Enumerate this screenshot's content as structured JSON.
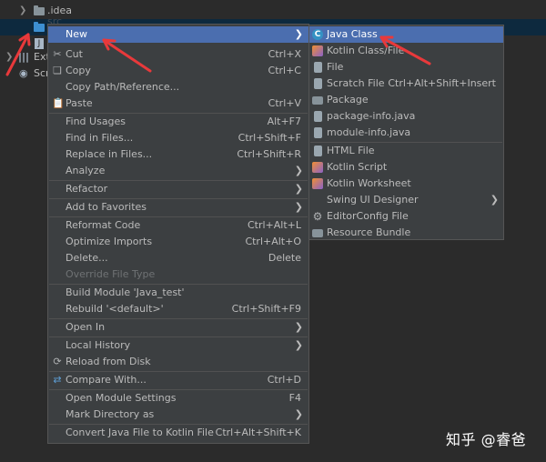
{
  "tree": {
    "items": [
      {
        "label": ".idea"
      },
      {
        "label": "src"
      },
      {
        "label": "J"
      },
      {
        "label": "Ext"
      },
      {
        "label": "Scr"
      }
    ]
  },
  "menu": {
    "items": [
      {
        "label": "New",
        "shortcut": "",
        "icon": "none"
      },
      {
        "label": "Cut",
        "shortcut": "Ctrl+X",
        "icon": "scissors-icon"
      },
      {
        "label": "Copy",
        "shortcut": "Ctrl+C",
        "icon": "copy-icon"
      },
      {
        "label": "Copy Path/Reference...",
        "shortcut": "",
        "icon": "none"
      },
      {
        "label": "Paste",
        "shortcut": "Ctrl+V",
        "icon": "paste-icon"
      },
      {
        "label": "Find Usages",
        "shortcut": "Alt+F7",
        "icon": "none"
      },
      {
        "label": "Find in Files...",
        "shortcut": "Ctrl+Shift+F",
        "icon": "none"
      },
      {
        "label": "Replace in Files...",
        "shortcut": "Ctrl+Shift+R",
        "icon": "none"
      },
      {
        "label": "Analyze",
        "shortcut": "",
        "icon": "none"
      },
      {
        "label": "Refactor",
        "shortcut": "",
        "icon": "none"
      },
      {
        "label": "Add to Favorites",
        "shortcut": "",
        "icon": "none"
      },
      {
        "label": "Reformat Code",
        "shortcut": "Ctrl+Alt+L",
        "icon": "none"
      },
      {
        "label": "Optimize Imports",
        "shortcut": "Ctrl+Alt+O",
        "icon": "none"
      },
      {
        "label": "Delete...",
        "shortcut": "Delete",
        "icon": "none"
      },
      {
        "label": "Override File Type",
        "shortcut": "",
        "icon": "none"
      },
      {
        "label": "Build Module 'Java_test'",
        "shortcut": "",
        "icon": "none"
      },
      {
        "label": "Rebuild '<default>'",
        "shortcut": "Ctrl+Shift+F9",
        "icon": "none"
      },
      {
        "label": "Open In",
        "shortcut": "",
        "icon": "none"
      },
      {
        "label": "Local History",
        "shortcut": "",
        "icon": "none"
      },
      {
        "label": "Reload from Disk",
        "shortcut": "",
        "icon": "reload-icon"
      },
      {
        "label": "Compare With...",
        "shortcut": "Ctrl+D",
        "icon": "compare-icon"
      },
      {
        "label": "Open Module Settings",
        "shortcut": "F4",
        "icon": "none"
      },
      {
        "label": "Mark Directory as",
        "shortcut": "",
        "icon": "none"
      },
      {
        "label": "Convert Java File to Kotlin File",
        "shortcut": "Ctrl+Alt+Shift+K",
        "icon": "none"
      }
    ]
  },
  "submenu": {
    "items": [
      {
        "label": "Java Class",
        "shortcut": "",
        "icon": "java-class-icon"
      },
      {
        "label": "Kotlin Class/File",
        "shortcut": "",
        "icon": "kotlin-icon"
      },
      {
        "label": "File",
        "shortcut": "",
        "icon": "file-icon"
      },
      {
        "label": "Scratch File",
        "shortcut": "Ctrl+Alt+Shift+Insert",
        "icon": "scratch-file-icon"
      },
      {
        "label": "Package",
        "shortcut": "",
        "icon": "package-icon"
      },
      {
        "label": "package-info.java",
        "shortcut": "",
        "icon": "java-file-icon"
      },
      {
        "label": "module-info.java",
        "shortcut": "",
        "icon": "java-file-icon"
      },
      {
        "label": "HTML File",
        "shortcut": "",
        "icon": "html-file-icon"
      },
      {
        "label": "Kotlin Script",
        "shortcut": "",
        "icon": "kotlin-icon"
      },
      {
        "label": "Kotlin Worksheet",
        "shortcut": "",
        "icon": "kotlin-icon"
      },
      {
        "label": "Swing UI Designer",
        "shortcut": "",
        "icon": "none"
      },
      {
        "label": "EditorConfig File",
        "shortcut": "",
        "icon": "gear-icon"
      },
      {
        "label": "Resource Bundle",
        "shortcut": "",
        "icon": "resource-bundle-icon"
      }
    ]
  },
  "watermark": "知乎 @睿爸",
  "colors": {
    "background": "#2b2b2b",
    "menu_bg": "#3c3f41",
    "highlight": "#4b6eaf",
    "annotation": "#e8393b"
  }
}
